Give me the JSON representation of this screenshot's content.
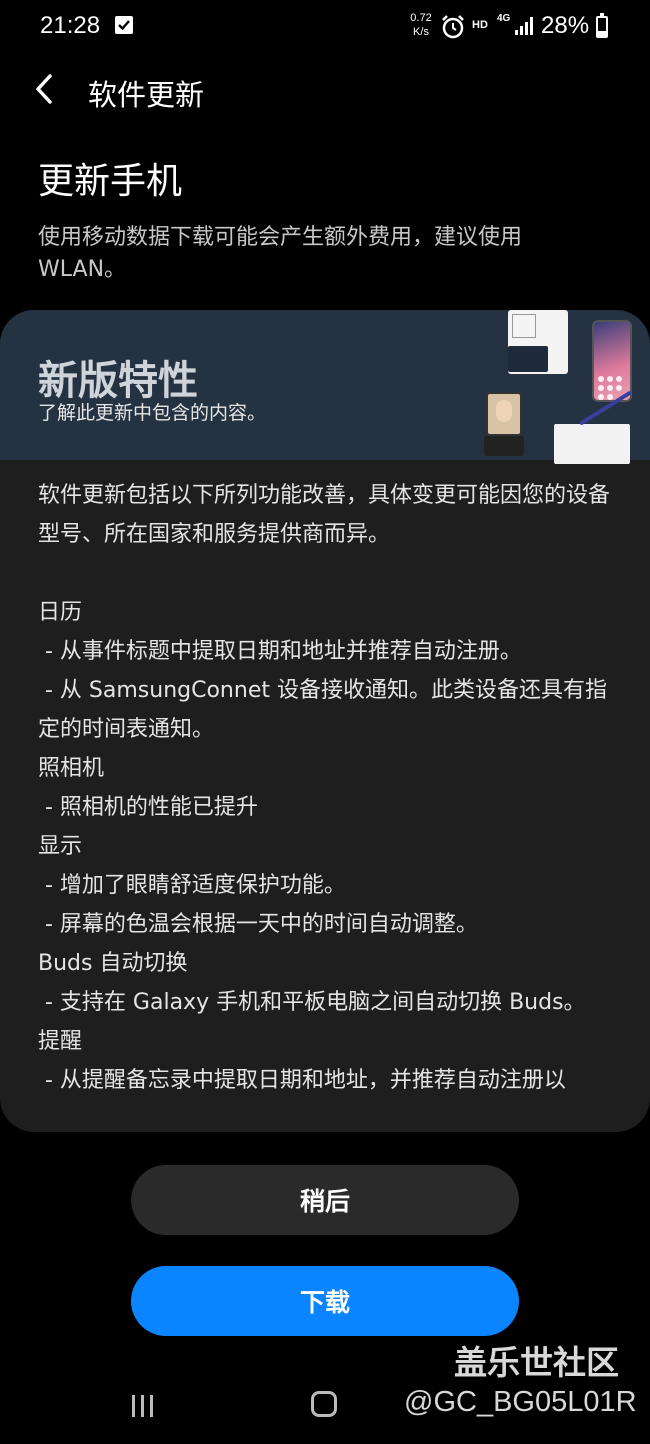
{
  "status_bar": {
    "time": "21:28",
    "net_speed_value": "0.72",
    "net_speed_unit": "K/s",
    "hd": "HD",
    "network": "4G",
    "battery_text": "28%",
    "battery_level": 0.28
  },
  "header": {
    "title": "软件更新"
  },
  "page": {
    "title": "更新手机",
    "subtitle": "使用移动数据下载可能会产生额外费用，建议使用 WLAN。"
  },
  "features": {
    "banner_title": "新版特性",
    "banner_subtitle": "了解此更新中包含的内容。",
    "intro": "软件更新包括以下所列功能改善，具体变更可能因您的设备型号、所在国家和服务提供商而异。",
    "lines": [
      "日历",
      " - 从事件标题中提取日期和地址并推荐自动注册。",
      " - 从 SamsungConnet 设备接收通知。此类设备还具有指定的时间表通知。",
      "照相机",
      " - 照相机的性能已提升",
      "显示",
      " - 增加了眼睛舒适度保护功能。",
      " - 屏幕的色温会根据一天中的时间自动调整。",
      "Buds 自动切换",
      " - 支持在 Galaxy 手机和平板电脑之间自动切换 Buds。",
      "提醒",
      " - 从提醒备忘录中提取日期和地址，并推荐自动注册以"
    ]
  },
  "buttons": {
    "later": "稍后",
    "download": "下载"
  },
  "watermark": {
    "line1": "盖乐世社区",
    "line2": "@GC_BG05L01R"
  },
  "colors": {
    "accent": "#0a84ff",
    "card": "#1e1e1e",
    "banner": "#243242"
  }
}
